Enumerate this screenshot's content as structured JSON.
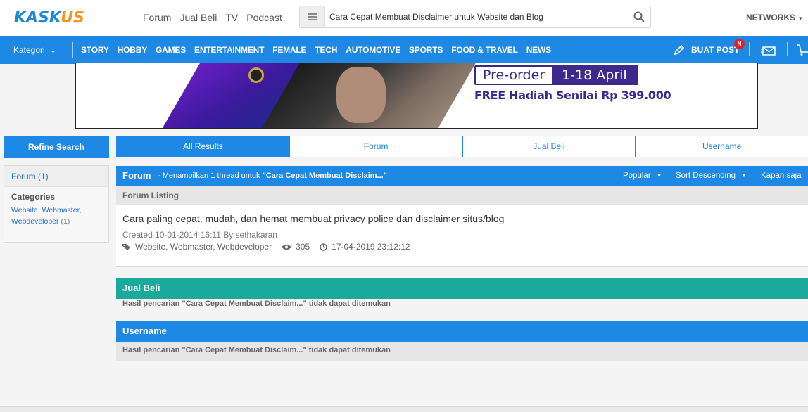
{
  "header": {
    "logo_main": "KASK",
    "logo_accent": "US",
    "nav": [
      "Forum",
      "Jual Beli",
      "TV",
      "Podcast"
    ],
    "search_value": "Cara Cepat Membuat Disclaimer untuk Website dan Blog",
    "networks_label": "NETWORKS"
  },
  "navbar": {
    "kategori_label": "Kategori",
    "categories": [
      "STORY",
      "HOBBY",
      "GAMES",
      "ENTERTAINMENT",
      "FEMALE",
      "TECH",
      "AUTOMOTIVE",
      "SPORTS",
      "FOOD & TRAVEL",
      "NEWS"
    ],
    "buat_post_label": "BUAT POST",
    "notif_badge": "N"
  },
  "banner": {
    "preorder_label": "Pre-order",
    "preorder_dates": "1-18 April",
    "free_text": "FREE Hadiah Senilai Rp 399.000"
  },
  "sidebar": {
    "refine_label": "Refine Search",
    "forum_facet": "Forum (1)",
    "categories_title": "Categories",
    "category_link": "Website, Webmaster, Webdeveloper",
    "category_count": "(1)"
  },
  "tabs": [
    "All Results",
    "Forum",
    "Jual Beli",
    "Username"
  ],
  "forum_section": {
    "title": "Forum",
    "subtitle_prefix": "- Menampilkan 1 thread untuk ",
    "query": "\"Cara Cepat Membuat Disclaim...\"",
    "sort_popular": "Popular",
    "sort_order": "Sort Descending",
    "sort_time": "Kapan saja",
    "listing_label": "Forum Listing",
    "thread": {
      "title": "Cara paling cepat, mudah, dan hemat membuat privacy police dan disclaimer situs/blog",
      "created": "Created 10-01-2014 16:11 By sethakaran",
      "tags": "Website, Webmaster, Webdeveloper",
      "views": "305",
      "last_update": "17-04-2019 23:12:12"
    }
  },
  "jual_beli_section": {
    "title": "Jual Beli",
    "message": "Hasil pencarian \"Cara Cepat Membuat Disclaim...\" tidak dapat ditemukan"
  },
  "username_section": {
    "title": "Username",
    "message": "Hasil pencarian \"Cara Cepat Membuat Disclaim...\" tidak dapat ditemukan"
  },
  "colors": {
    "brand_blue": "#1e88e5",
    "jual_beli_teal": "#1ba99b",
    "logo_orange": "#f7941d",
    "badge_red": "#e0232b"
  }
}
